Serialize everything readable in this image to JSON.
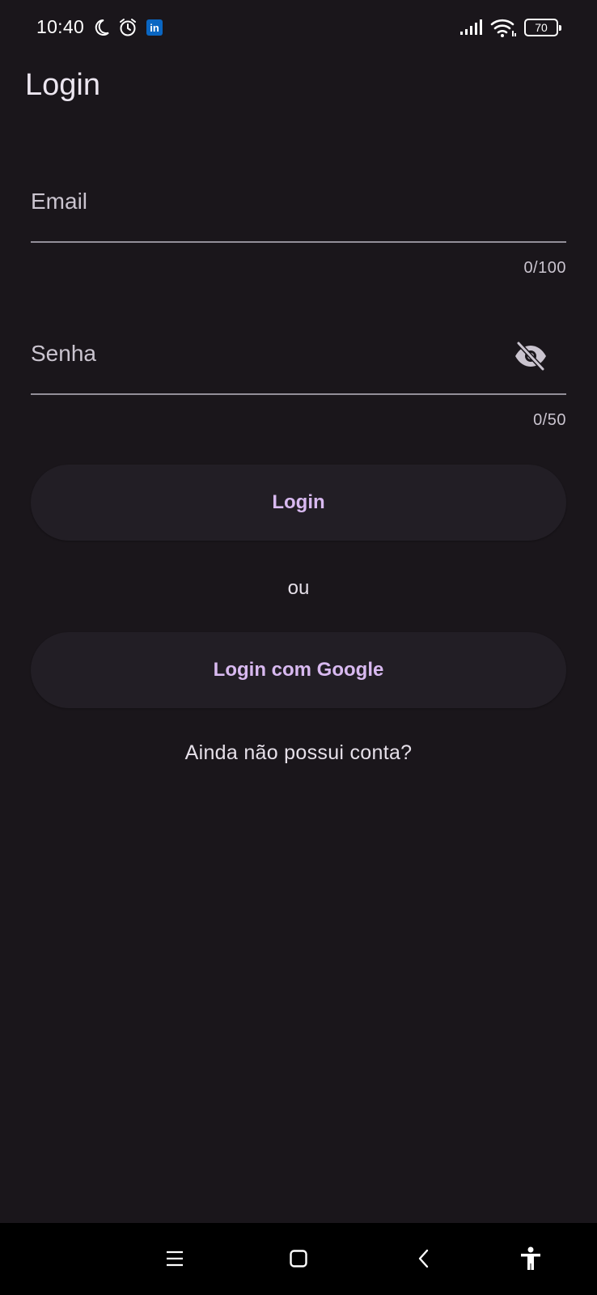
{
  "status_bar": {
    "time": "10:40",
    "icons": [
      "moon-icon",
      "alarm-icon",
      "linkedin-icon",
      "signal-icon",
      "wifi-icon",
      "battery-icon"
    ],
    "battery_level": "70"
  },
  "page": {
    "title": "Login"
  },
  "form": {
    "email": {
      "label": "Email",
      "value": "",
      "counter": "0/100"
    },
    "password": {
      "label": "Senha",
      "value": "",
      "counter": "0/50",
      "toggle_icon": "visibility-off-icon"
    },
    "login_button": "Login",
    "separator": "ou",
    "google_button": "Login com Google",
    "signup_link": "Ainda não possui conta?"
  },
  "nav_bar": {
    "icons": [
      "menu-icon",
      "home-icon",
      "back-icon",
      "accessibility-icon"
    ]
  },
  "colors": {
    "background": "#1a161b",
    "button_surface": "#221e25",
    "accent": "#d8b9f0",
    "underline": "#938f99"
  }
}
